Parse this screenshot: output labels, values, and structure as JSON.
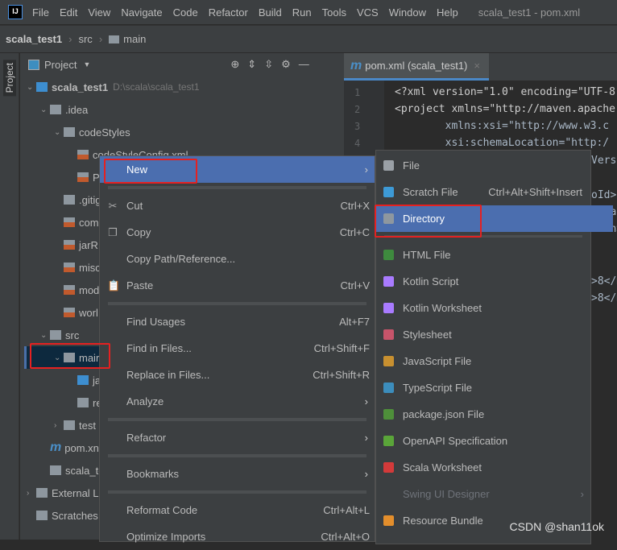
{
  "menubar": {
    "logo": "IJ",
    "items": [
      "File",
      "Edit",
      "View",
      "Navigate",
      "Code",
      "Refactor",
      "Build",
      "Run",
      "Tools",
      "VCS",
      "Window",
      "Help"
    ],
    "window_title": "scala_test1 - pom.xml"
  },
  "breadcrumb": {
    "project": "scala_test1",
    "items": [
      "src",
      "main"
    ]
  },
  "side_strip": {
    "label": "Project"
  },
  "project_panel": {
    "title": "Project",
    "tools": [
      "locate-icon",
      "expand-all-icon",
      "collapse-all-icon",
      "gear-icon",
      "minimize-icon"
    ]
  },
  "tree": [
    {
      "label": "scala_test1",
      "path": "D:\\scala\\scala_test1",
      "depth": 0,
      "chev": "v",
      "icon": "module",
      "bold": true
    },
    {
      "label": ".idea",
      "depth": 1,
      "chev": "v",
      "icon": "folder"
    },
    {
      "label": "codeStyles",
      "depth": 2,
      "chev": "v",
      "icon": "folder"
    },
    {
      "label": "codeStyleConfig.xml",
      "depth": 3,
      "icon": "xml"
    },
    {
      "label": "P",
      "depth": 3,
      "icon": "xml"
    },
    {
      "label": ".gitig",
      "depth": 2,
      "icon": "gitignore"
    },
    {
      "label": "com",
      "depth": 2,
      "icon": "xml"
    },
    {
      "label": "jarR",
      "depth": 2,
      "icon": "xml"
    },
    {
      "label": "misc",
      "depth": 2,
      "icon": "xml"
    },
    {
      "label": "mod",
      "depth": 2,
      "icon": "xml"
    },
    {
      "label": "worl",
      "depth": 2,
      "icon": "xml"
    },
    {
      "label": "src",
      "depth": 1,
      "chev": "v",
      "icon": "folder"
    },
    {
      "label": "mair",
      "depth": 2,
      "chev": "v",
      "icon": "folder",
      "selected": true
    },
    {
      "label": "ja",
      "depth": 3,
      "icon": "blue"
    },
    {
      "label": "re",
      "depth": 3,
      "icon": "folder"
    },
    {
      "label": "test",
      "depth": 2,
      "chev": ">",
      "icon": "folder"
    },
    {
      "label": "pom.xn",
      "depth": 1,
      "icon": "maven"
    },
    {
      "label": "scala_te",
      "depth": 1,
      "icon": "file"
    },
    {
      "label": "External Li",
      "depth": 0,
      "chev": ">",
      "icon": "library"
    },
    {
      "label": "Scratches",
      "depth": 0,
      "icon": "scratch"
    }
  ],
  "editor": {
    "tab": "pom.xml (scala_test1)",
    "lines": [
      "1",
      "2",
      "3",
      "4"
    ],
    "code": [
      "<?xml version=\"1.0\" encoding=\"UTF-8",
      "<project xmlns=\"http://maven.apache",
      "        xmlns:xsi=\"http://www.w3.c",
      "        xsi:schemaLocation=\"http:/"
    ],
    "fragments": [
      "Versi",
      "oId>",
      "tifac",
      "sion>",
      ">8</m",
      ">8</m"
    ]
  },
  "context_menu": [
    {
      "label": "New",
      "arrow": true,
      "hl": true
    },
    {
      "sep": true
    },
    {
      "label": "Cut",
      "shortcut": "Ctrl+X",
      "icon": "✂",
      "iconName": "scissors-icon"
    },
    {
      "label": "Copy",
      "shortcut": "Ctrl+C",
      "icon": "❐",
      "iconName": "copy-icon"
    },
    {
      "label": "Copy Path/Reference..."
    },
    {
      "label": "Paste",
      "shortcut": "Ctrl+V",
      "icon": "📋",
      "iconName": "clipboard-icon"
    },
    {
      "sep": true
    },
    {
      "label": "Find Usages",
      "shortcut": "Alt+F7"
    },
    {
      "label": "Find in Files...",
      "shortcut": "Ctrl+Shift+F"
    },
    {
      "label": "Replace in Files...",
      "shortcut": "Ctrl+Shift+R"
    },
    {
      "label": "Analyze",
      "arrow": true
    },
    {
      "sep": true
    },
    {
      "label": "Refactor",
      "arrow": true
    },
    {
      "sep": true
    },
    {
      "label": "Bookmarks",
      "arrow": true
    },
    {
      "sep": true
    },
    {
      "label": "Reformat Code",
      "shortcut": "Ctrl+Alt+L"
    },
    {
      "label": "Optimize Imports",
      "shortcut": "Ctrl+Alt+O"
    }
  ],
  "new_submenu": [
    {
      "label": "File",
      "iconName": "file-icon",
      "color": "#9aa0a6"
    },
    {
      "label": "Scratch File",
      "shortcut": "Ctrl+Alt+Shift+Insert",
      "iconName": "scratch-file-icon",
      "color": "#3d9ad6"
    },
    {
      "label": "Directory",
      "hl": true,
      "iconName": "folder-icon",
      "color": "#8e979f"
    },
    {
      "sep": true
    },
    {
      "label": "HTML File",
      "iconName": "html-file-icon",
      "color": "#3e8a3e"
    },
    {
      "label": "Kotlin Script",
      "iconName": "kotlin-script-icon",
      "color": "#a97bff"
    },
    {
      "label": "Kotlin Worksheet",
      "iconName": "kotlin-worksheet-icon",
      "color": "#a97bff"
    },
    {
      "label": "Stylesheet",
      "iconName": "css-file-icon",
      "color": "#c7546a"
    },
    {
      "label": "JavaScript File",
      "iconName": "js-file-icon",
      "color": "#c89030"
    },
    {
      "label": "TypeScript File",
      "iconName": "ts-file-icon",
      "color": "#3c8dbc"
    },
    {
      "label": "package.json File",
      "iconName": "nodejs-icon",
      "color": "#4e8f3a"
    },
    {
      "label": "OpenAPI Specification",
      "iconName": "openapi-icon",
      "color": "#5aa539"
    },
    {
      "label": "Scala Worksheet",
      "iconName": "scala-worksheet-icon",
      "color": "#d33a3a"
    },
    {
      "label": "Swing UI Designer",
      "arrow": true,
      "disabled": true
    },
    {
      "label": "Resource Bundle",
      "iconName": "resource-bundle-icon",
      "color": "#e38e2c"
    }
  ],
  "watermark": "CSDN @shan11ok",
  "colors": {
    "highlight": "#4b6eaf",
    "annotation_box": "#e52121",
    "selection": "#0d293e"
  }
}
